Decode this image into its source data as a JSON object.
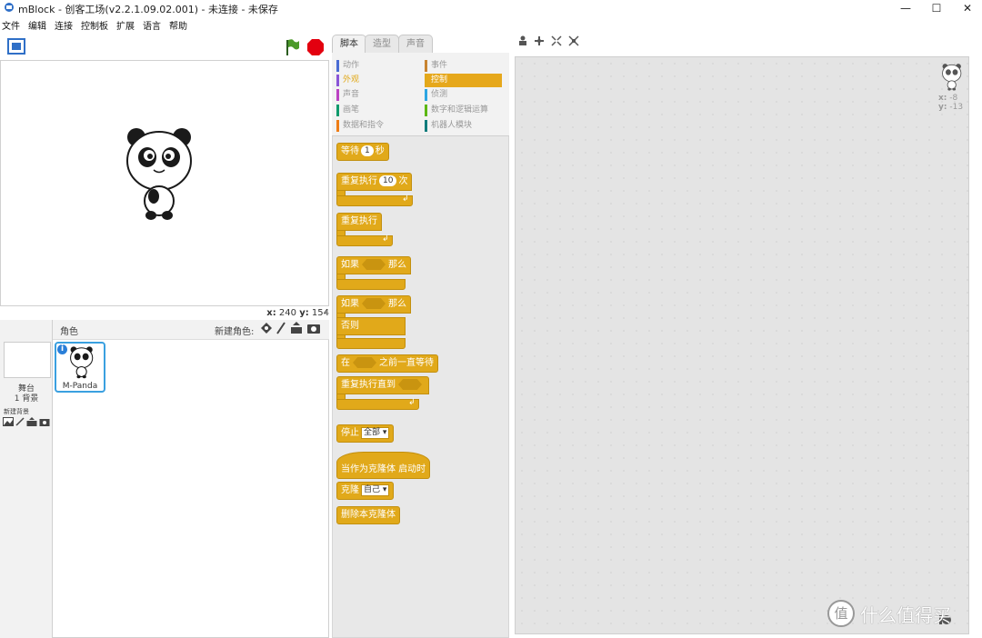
{
  "window": {
    "title": "mBlock - 创客工场(v2.2.1.09.02.001) - 未连接 - 未保存",
    "minimize": "—",
    "maximize": "☐",
    "close": "✕"
  },
  "menu": [
    "文件",
    "编辑",
    "连接",
    "控制板",
    "扩展",
    "语言",
    "帮助"
  ],
  "stage": {
    "coords": {
      "x_label": "x:",
      "x": "240",
      "y_label": "y:",
      "y": "154"
    }
  },
  "sprites": {
    "header_label": "角色",
    "new_sprite_label": "新建角色:",
    "stage_label": "舞台",
    "backdrops": "1 背景",
    "new_backdrop_label": "新建背景",
    "sprite_name": "M-Panda"
  },
  "tabs": [
    "脚本",
    "造型",
    "声音"
  ],
  "categories": [
    {
      "label": "动作",
      "color": "#4a6cd4"
    },
    {
      "label": "事件",
      "color": "#c88330"
    },
    {
      "label": "外观",
      "color": "#8a55d7"
    },
    {
      "label": "控制",
      "color": "#e1a91a"
    },
    {
      "label": "声音",
      "color": "#bb42c3"
    },
    {
      "label": "侦测",
      "color": "#2ca5e2"
    },
    {
      "label": "画笔",
      "color": "#0e9a6c"
    },
    {
      "label": "数字和逻辑运算",
      "color": "#5cb712"
    },
    {
      "label": "数据和指令",
      "color": "#ee7d16"
    },
    {
      "label": "机器人模块",
      "color": "#107c7c"
    }
  ],
  "active_category": "控制",
  "blocks": {
    "wait": {
      "text": "等待",
      "value": "1",
      "unit": "秒"
    },
    "repeat": {
      "text": "重复执行",
      "value": "10",
      "unit": "次"
    },
    "forever": {
      "text": "重复执行"
    },
    "if_then": {
      "text": "如果",
      "then": "那么"
    },
    "if_else": {
      "text": "如果",
      "then": "那么",
      "else": "否则"
    },
    "wait_until": {
      "text": "在",
      "suffix": "之前一直等待"
    },
    "repeat_until": {
      "text": "重复执行直到"
    },
    "stop": {
      "text": "停止",
      "option": "全部"
    },
    "clone_start": {
      "text": "当作为克隆体 启动时"
    },
    "clone": {
      "text": "克隆",
      "option": "自己"
    },
    "delete_clone": {
      "text": "删除本克隆体"
    }
  },
  "script_area": {
    "x_label": "x:",
    "x": "-8",
    "y_label": "y:",
    "y": "-13"
  },
  "watermark": {
    "text": "什么值得买",
    "badge": "值"
  }
}
